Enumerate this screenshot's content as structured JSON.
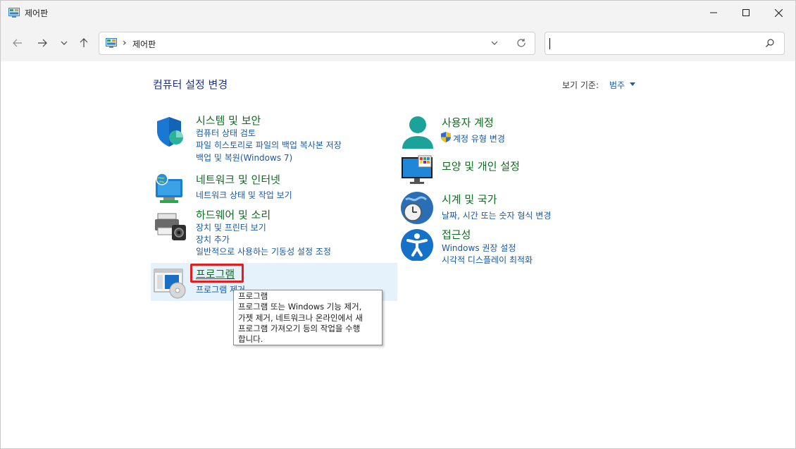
{
  "window": {
    "title": "제어판",
    "minimize_glyph": "—",
    "maximize_glyph": "☐",
    "close_glyph": "✕"
  },
  "nav": {
    "back_icon": "arrow-left-icon",
    "forward_icon": "arrow-right-icon",
    "recent_icon": "chevron-down-icon",
    "up_icon": "arrow-up-icon",
    "breadcrumb": "제어판",
    "search_placeholder": ""
  },
  "content": {
    "title": "컴퓨터 설정 변경",
    "view_by_label": "보기 기준:",
    "view_by_value": "범주"
  },
  "categories": [
    {
      "heading": "시스템 및 보안",
      "icon": "shield-icon",
      "links": [
        "컴퓨터 상태 검토",
        "파일 히스토리로 파일의 백업 복사본 저장",
        "백업 및 복원(Windows 7)"
      ]
    },
    {
      "heading": "네트워크 및 인터넷",
      "icon": "network-globe-icon",
      "links": [
        "네트워크 상태 및 작업 보기"
      ]
    },
    {
      "heading": "하드웨어 및 소리",
      "icon": "printer-camera-icon",
      "links": [
        "장치 및 프린터 보기",
        "장치 추가",
        "일반적으로 사용하는 기동성 설정 조정"
      ]
    },
    {
      "heading": "프로그램",
      "icon": "programs-disc-icon",
      "links": [
        "프로그램 제거"
      ]
    },
    {
      "heading": "사용자 계정",
      "icon": "user-icon",
      "links": [
        "계정 유형 변경"
      ]
    },
    {
      "heading": "모양 및 개인 설정",
      "icon": "monitor-colors-icon",
      "links": []
    },
    {
      "heading": "시계 및 국가",
      "icon": "clock-globe-icon",
      "links": [
        "날짜, 시간 또는 숫자 형식 변경"
      ]
    },
    {
      "heading": "접근성",
      "icon": "accessibility-icon",
      "links": [
        "Windows 권장 설정",
        "시각적 디스플레이 최적화"
      ]
    }
  ],
  "tooltip": {
    "lines": [
      "프로그램",
      "프로그램 또는 Windows 기능 제거,",
      "가젯 제거, 네트워크나 온라인에서 새",
      "프로그램 가져오기 등의 작업을 수행",
      "합니다."
    ]
  },
  "colors": {
    "heading_green": "#0a6e1e",
    "link_blue": "#1a5aa0",
    "title_blue": "#1e3287",
    "hover_bg": "#e5f1fb",
    "highlight_red": "#e02020"
  }
}
